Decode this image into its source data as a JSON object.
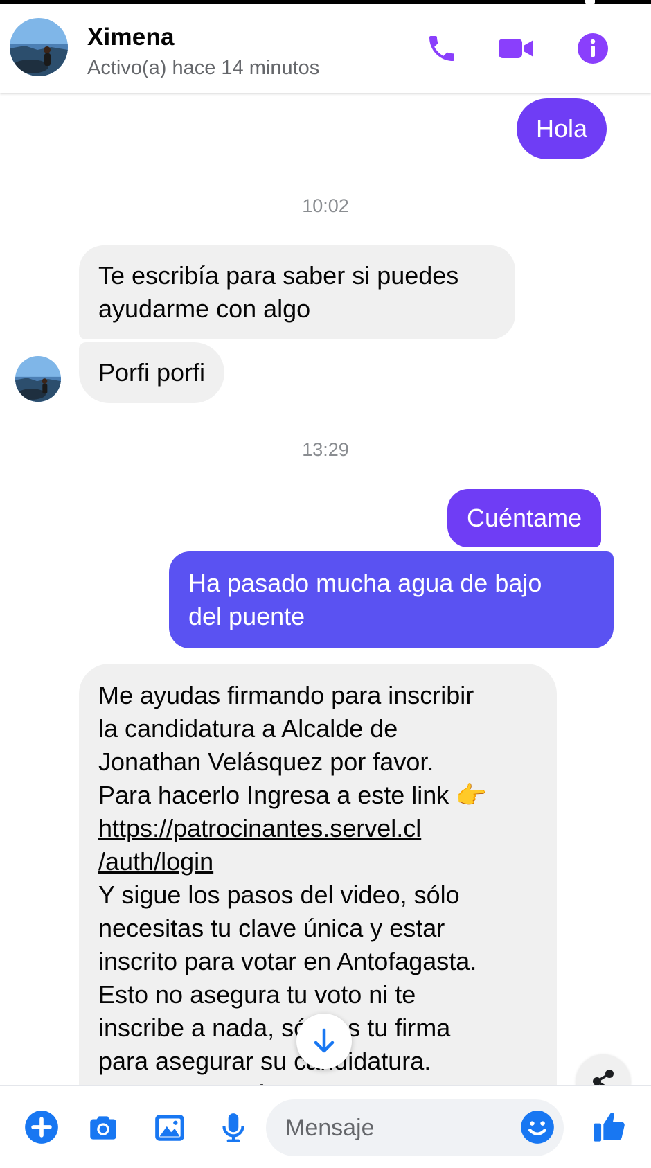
{
  "contact": {
    "name": "Ximena",
    "status": "Activo(a) hace 14 minutos"
  },
  "header_icons": [
    "phone-icon",
    "video-camera-icon",
    "info-icon"
  ],
  "messages": [
    {
      "type": "outgoing",
      "text": "Hola"
    },
    {
      "type": "timestamp",
      "text": "10:02"
    },
    {
      "type": "incoming",
      "lines": [
        "Te escribía para saber si puedes",
        "ayudarme con algo"
      ]
    },
    {
      "type": "incoming",
      "text": "Porfi porfi"
    },
    {
      "type": "timestamp",
      "text": "13:29"
    },
    {
      "type": "outgoing",
      "text": "Cuéntame"
    },
    {
      "type": "outgoing",
      "lines": [
        "Ha pasado mucha agua de bajo",
        "del puente"
      ]
    },
    {
      "type": "incoming",
      "lines": [
        "Me ayudas firmando para inscribir",
        "la candidatura a Alcalde de",
        "Jonathan Velásquez por favor.",
        "Para hacerlo Ingresa a este link 👉",
        "https://patrocinantes.servel.cl",
        "/auth/login",
        "Y sigue los pasos del video, sólo",
        "necesitas tu clave única y estar",
        "inscrito para votar en Antofagasta.",
        "Esto no asegura tu voto ni te",
        "inscribe a nada, sólo es tu firma",
        "para asegurar su candidatura.",
        "Luego me envías el pantallazo o"
      ]
    }
  ],
  "composer": {
    "placeholder": "Mensaje",
    "icons": [
      "add-icon",
      "camera-icon",
      "gallery-icon",
      "microphone-icon",
      "emoji-icon",
      "thumbs-up-icon"
    ]
  },
  "colors": {
    "accent": "#8a3ffc",
    "outgoing_bubble_top": "#6f3df5",
    "outgoing_bubble_bottom": "#5a52f2",
    "incoming_bubble": "#f0f0f0",
    "composer_icon": "#1877f2"
  }
}
